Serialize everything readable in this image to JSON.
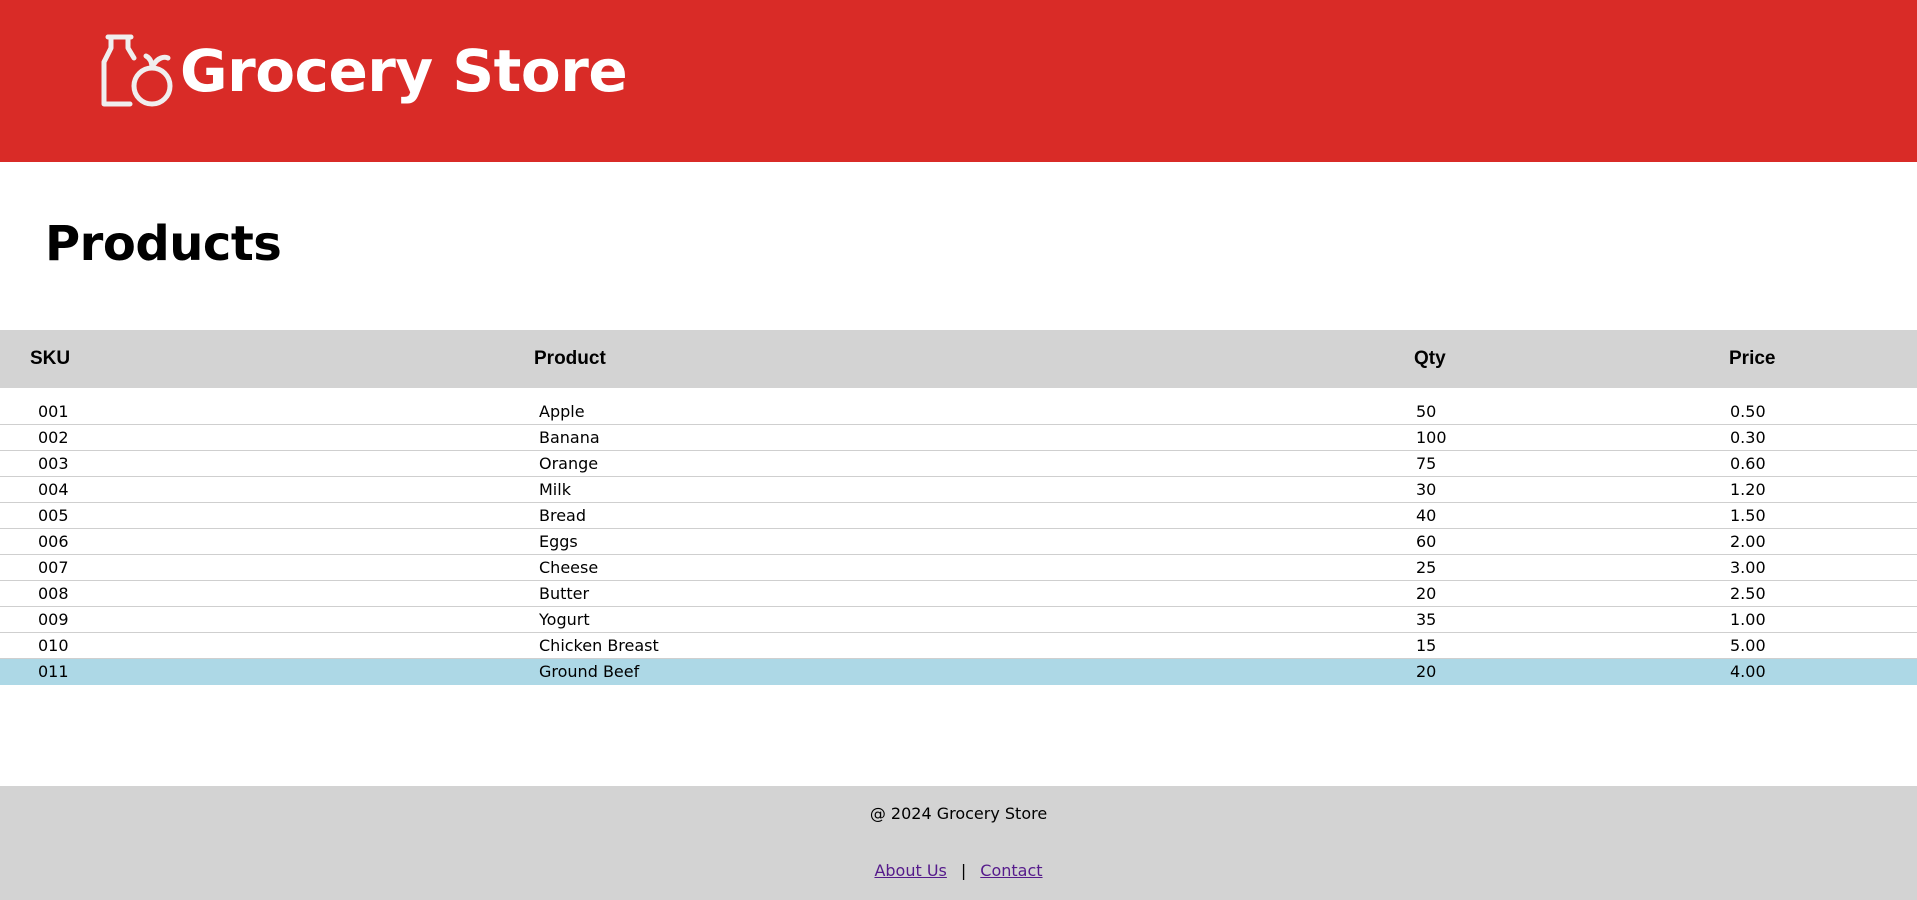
{
  "header": {
    "logo_text": "Grocery Store",
    "logo_icon": "grocery-bottle-apple-icon",
    "background_color": "#d92b27"
  },
  "main": {
    "title": "Products"
  },
  "table": {
    "columns": [
      "SKU",
      "Product",
      "Qty",
      "Price"
    ],
    "rows": [
      {
        "sku": "001",
        "product": "Apple",
        "qty": "50",
        "price": "0.50"
      },
      {
        "sku": "002",
        "product": "Banana",
        "qty": "100",
        "price": "0.30"
      },
      {
        "sku": "003",
        "product": "Orange",
        "qty": "75",
        "price": "0.60"
      },
      {
        "sku": "004",
        "product": "Milk",
        "qty": "30",
        "price": "1.20"
      },
      {
        "sku": "005",
        "product": "Bread",
        "qty": "40",
        "price": "1.50"
      },
      {
        "sku": "006",
        "product": "Eggs",
        "qty": "60",
        "price": "2.00"
      },
      {
        "sku": "007",
        "product": "Cheese",
        "qty": "25",
        "price": "3.00"
      },
      {
        "sku": "008",
        "product": "Butter",
        "qty": "20",
        "price": "2.50"
      },
      {
        "sku": "009",
        "product": "Yogurt",
        "qty": "35",
        "price": "1.00"
      },
      {
        "sku": "010",
        "product": "Chicken Breast",
        "qty": "15",
        "price": "5.00"
      },
      {
        "sku": "011",
        "product": "Ground Beef",
        "qty": "20",
        "price": "4.00"
      }
    ],
    "highlight_color": "#add8e6",
    "header_color": "#d3d3d3"
  },
  "footer": {
    "copyright": "@ 2024 Grocery Store",
    "links": [
      "About Us",
      "Contact"
    ],
    "separator": "|"
  }
}
